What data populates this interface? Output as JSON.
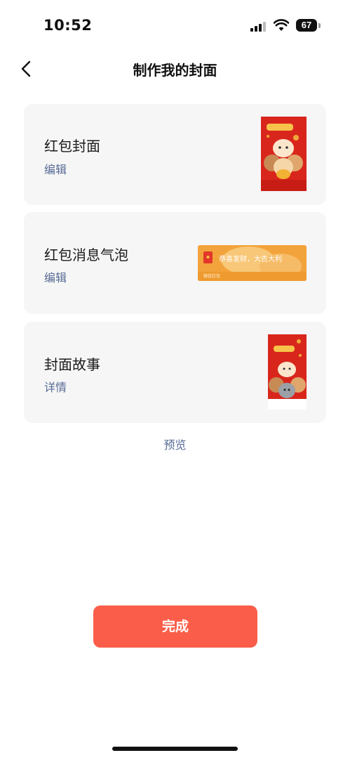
{
  "status_bar": {
    "time": "10:52",
    "battery": "67"
  },
  "nav": {
    "title": "制作我的封面",
    "back_icon": "chevron-left-icon"
  },
  "cards": [
    {
      "title": "红包封面",
      "action": "编辑",
      "thumbnail": "red-envelope-cover"
    },
    {
      "title": "红包消息气泡",
      "action": "编辑",
      "thumbnail": "message-bubble",
      "bubble_text": "恭喜发财，大吉大利",
      "bubble_footer": "微信红包"
    },
    {
      "title": "封面故事",
      "action": "详情",
      "thumbnail": "cover-story"
    }
  ],
  "preview_label": "预览",
  "done_label": "完成",
  "colors": {
    "link": "#576b95",
    "primary": "#fa5e4a",
    "card_bg": "#f6f6f6",
    "envelope_red": "#d9261c"
  }
}
